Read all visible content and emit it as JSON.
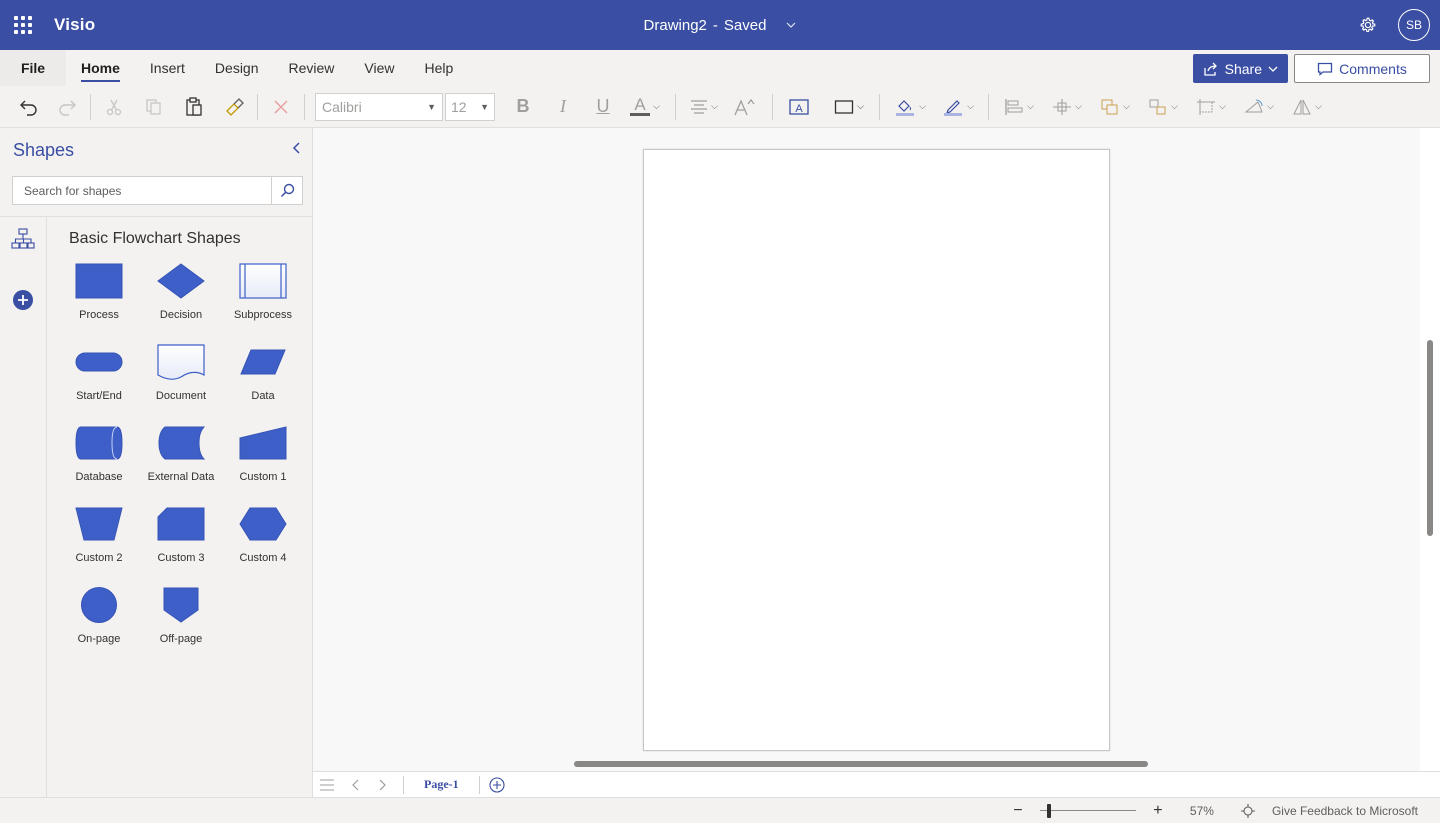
{
  "titlebar": {
    "app_name": "Visio",
    "doc_name": "Drawing2",
    "separator": "-",
    "save_status": "Saved",
    "avatar_initials": "SB",
    "color": "#3a4ea3"
  },
  "menubar": {
    "file": "File",
    "tabs": [
      {
        "label": "Home",
        "active": true
      },
      {
        "label": "Insert",
        "active": false
      },
      {
        "label": "Design",
        "active": false
      },
      {
        "label": "Review",
        "active": false
      },
      {
        "label": "View",
        "active": false
      },
      {
        "label": "Help",
        "active": false
      }
    ],
    "share": "Share",
    "comments": "Comments"
  },
  "toolbar": {
    "font_name": "Calibri",
    "font_size": "12",
    "bold": "B",
    "italic": "I",
    "underline": "U",
    "font_color": "A"
  },
  "shapes_panel": {
    "title": "Shapes",
    "search_placeholder": "Search for shapes",
    "stencil_title": "Basic Flowchart Shapes",
    "shapes": [
      {
        "label": "Process",
        "icon": "process"
      },
      {
        "label": "Decision",
        "icon": "decision"
      },
      {
        "label": "Subprocess",
        "icon": "subprocess"
      },
      {
        "label": "Start/End",
        "icon": "start-end"
      },
      {
        "label": "Document",
        "icon": "document"
      },
      {
        "label": "Data",
        "icon": "data"
      },
      {
        "label": "Database",
        "icon": "database"
      },
      {
        "label": "External Data",
        "icon": "external-data"
      },
      {
        "label": "Custom 1",
        "icon": "custom-1"
      },
      {
        "label": "Custom 2",
        "icon": "custom-2"
      },
      {
        "label": "Custom 3",
        "icon": "custom-3"
      },
      {
        "label": "Custom 4",
        "icon": "custom-4"
      },
      {
        "label": "On-page",
        "icon": "on-page"
      },
      {
        "label": "Off-page",
        "icon": "off-page"
      }
    ],
    "shape_color": "#3f5fc8"
  },
  "pagebar": {
    "pages": [
      "Page-1"
    ]
  },
  "statusbar": {
    "zoom_minus": "−",
    "zoom_plus": "+",
    "zoom_level": "57%",
    "zoom_fraction": 0.08,
    "feedback": "Give Feedback to Microsoft"
  }
}
